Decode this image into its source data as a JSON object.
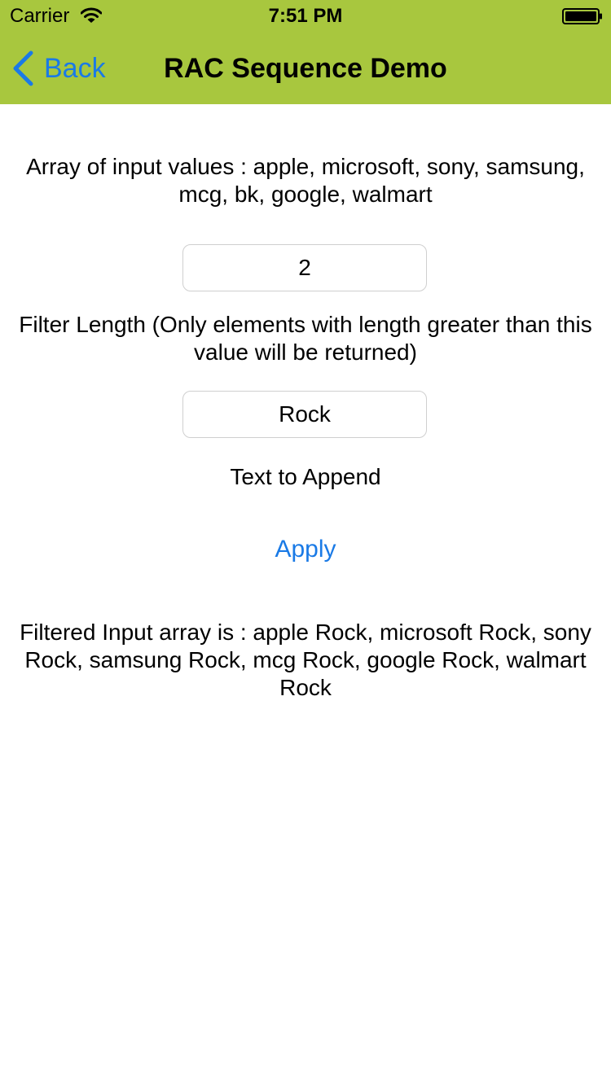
{
  "status_bar": {
    "carrier": "Carrier",
    "time": "7:51 PM",
    "wifi_icon": "wifi-icon",
    "battery_icon": "battery-icon"
  },
  "nav": {
    "back_label": "Back",
    "title": "RAC Sequence Demo",
    "background_color": "#a8c73e",
    "tint_color": "#1a7ae6",
    "back_icon": "chevron-left-icon"
  },
  "main": {
    "input_values_text": "Array of input values : apple, microsoft, sony, samsung, mcg, bk, google, walmart",
    "filter_length_value": "2",
    "filter_length_label": "Filter Length (Only elements with length greater than this value will be returned)",
    "append_text_value": "Rock",
    "append_text_label": "Text to Append",
    "apply_label": "Apply",
    "result_text": "Filtered Input array is : apple Rock, microsoft Rock, sony Rock, samsung Rock, mcg Rock, google Rock, walmart Rock"
  }
}
